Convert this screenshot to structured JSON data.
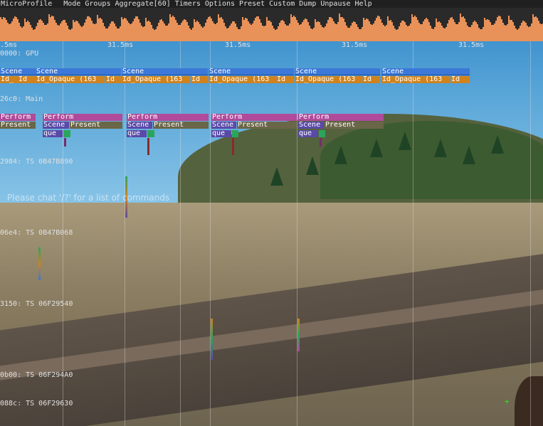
{
  "menubar": {
    "items": [
      "MicroProfile",
      "Mode",
      "Groups",
      "Aggregate[60]",
      "Timers",
      "Options",
      "Preset",
      "Custom",
      "Dump",
      "Unpause",
      "Help"
    ]
  },
  "timeline": {
    "ticks": [
      ".5ms",
      "31.5ms",
      "31.5ms",
      "31.5ms",
      "31.5ms"
    ]
  },
  "threads": {
    "gpu": "0000: GPU",
    "main": "26c0: Main",
    "ts1": "2984: TS 0B47B890",
    "ts2": "06e4: TS 0B47B068",
    "ts3": "3150: TS 06F29540",
    "ts4": "0b00: TS 06F294A0",
    "ts5": "088c: TS 06F29630"
  },
  "gpu_scenes": [
    {
      "scene": "Scene",
      "sub1": "Id_",
      "sub2": "Id"
    },
    {
      "scene": "Scene",
      "sub1": "Id_Opaque (163",
      "sub2": "Id"
    },
    {
      "scene": "Scene",
      "sub1": "Id_Opaque (163",
      "sub2": "Id"
    },
    {
      "scene": "Scene",
      "sub1": "Id_Opaque (163",
      "sub2": "Id"
    },
    {
      "scene": "Scene",
      "sub1": "Id_Opaque (163",
      "sub2": "Id"
    },
    {
      "scene": "Scene",
      "sub1": "Id_Opaque (163",
      "sub2": "Id"
    }
  ],
  "main_blocks": [
    {
      "perform": "Perform",
      "present": "Present",
      "scene": "",
      "queue": ""
    },
    {
      "perform": "Perform",
      "present": "Present",
      "scene": "Scene",
      "queue": "que"
    },
    {
      "perform": "Perform",
      "present": "Present",
      "scene": "Scene",
      "queue": "que"
    },
    {
      "perform": "Perform",
      "present": "Present",
      "scene": "Scene",
      "queue": "que"
    },
    {
      "perform": "Perform",
      "present": "Present",
      "scene": "Scene",
      "queue": "que"
    }
  ],
  "chat": {
    "hint": "Please chat '/?' for a list of commands"
  },
  "colors": {
    "history": "#e8925a",
    "scene_bar": "#3b78d8",
    "opaque_bar": "#d0821d",
    "perform_bar": "#b04a9a"
  }
}
